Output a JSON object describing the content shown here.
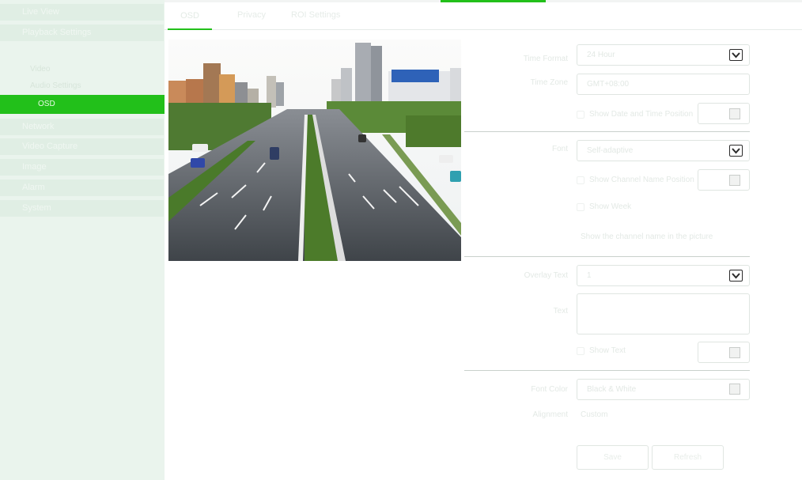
{
  "sidebar": {
    "items": [
      {
        "label": "Live View"
      },
      {
        "label": "Playback Settings"
      },
      {
        "label": "Network"
      },
      {
        "label": "Video Capture"
      },
      {
        "label": "Image"
      },
      {
        "label": "Alarm"
      },
      {
        "label": "System"
      }
    ],
    "sub_items": [
      {
        "label": "Video"
      },
      {
        "label": "Audio Settings"
      },
      {
        "label": "OSD"
      }
    ]
  },
  "tabs": [
    {
      "label": "OSD"
    },
    {
      "label": "Privacy"
    },
    {
      "label": "ROI Settings"
    }
  ],
  "form": {
    "sections": [
      {
        "fields": [
          {
            "label": "Time Format",
            "type": "select",
            "value": "24 Hour"
          },
          {
            "label": "Time Zone",
            "type": "input",
            "value": "GMT+08:00"
          },
          {
            "label": "Show Date and Time Position",
            "type": "check-swatch"
          }
        ]
      },
      {
        "fields": [
          {
            "label": "Font",
            "type": "select",
            "value": "Self-adaptive"
          },
          {
            "label": "Show Channel Name Position",
            "type": "check-swatch"
          },
          {
            "label": "Show Week",
            "type": "check"
          },
          {
            "label": "Show the channel name in the picture",
            "type": "note"
          }
        ]
      },
      {
        "fields": [
          {
            "label": "Overlay Text",
            "type": "select",
            "value": "1"
          },
          {
            "label": "Text",
            "type": "textarea"
          },
          {
            "label": "Show Text",
            "type": "check-swatch"
          }
        ]
      },
      {
        "fields": [
          {
            "label": "Font Color",
            "type": "color",
            "value": "Black & White"
          },
          {
            "label": "Alignment",
            "type": "note",
            "value": "Custom"
          }
        ]
      }
    ],
    "buttons": {
      "save": "Save",
      "refresh": "Refresh"
    }
  },
  "colors": {
    "accent": "#22c01a",
    "sidebar_bg": "#eaf4ed"
  }
}
